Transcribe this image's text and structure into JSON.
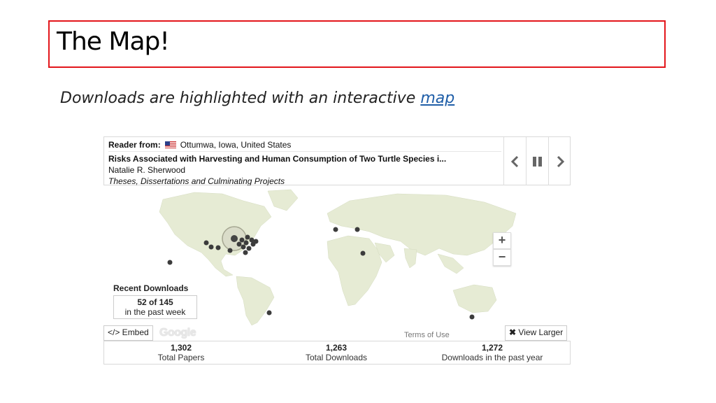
{
  "slide": {
    "title": "The Map!",
    "subtitle_text": "Downloads are highlighted with an interactive",
    "subtitle_link": "map"
  },
  "reader": {
    "label": "Reader from:",
    "location": "Ottumwa, Iowa, United States",
    "paper_title": "Risks Associated with Harvesting and Human Consumption of Two Turtle Species i...",
    "author": "Natalie R. Sherwood",
    "collection": "Theses, Dissertations and Culminating Projects"
  },
  "nav": {
    "prev": "‹",
    "next": "›"
  },
  "map": {
    "zoom_in": "+",
    "zoom_out": "−",
    "google_label": "Google",
    "terms": "Terms of Use",
    "land_color": "#e7ecd5",
    "marker_color": "#3c3c3c"
  },
  "recent": {
    "heading": "Recent Downloads",
    "count": "52 of 145",
    "period": "in the past week"
  },
  "buttons": {
    "embed": "</> Embed",
    "view_larger": "View Larger"
  },
  "stats": [
    {
      "value": "1,302",
      "label": "Total Papers"
    },
    {
      "value": "1,263",
      "label": "Total Downloads"
    },
    {
      "value": "1,272",
      "label": "Downloads in the past year"
    }
  ]
}
